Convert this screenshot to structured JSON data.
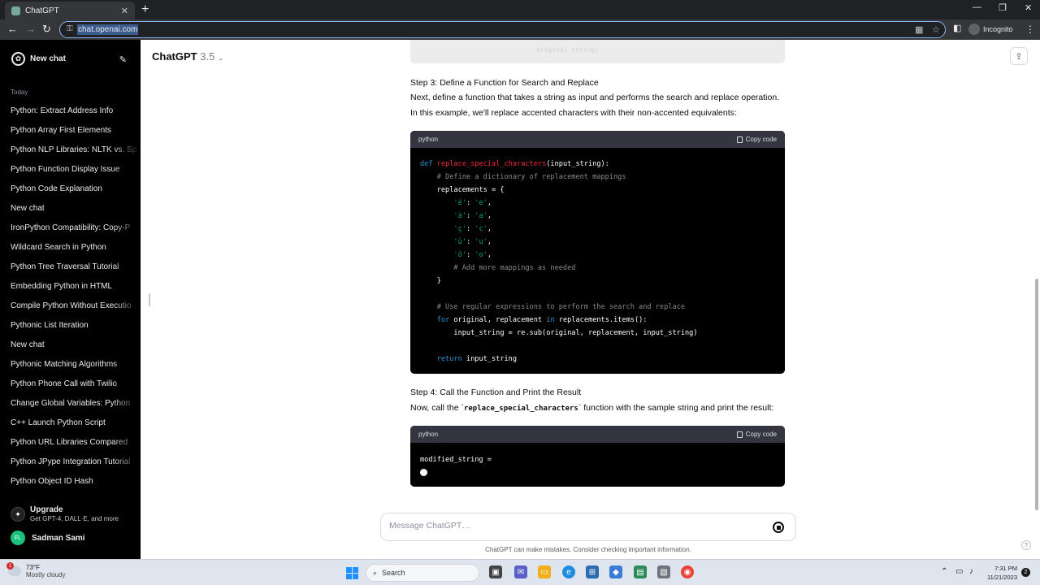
{
  "browser": {
    "tab_title": "ChatGPT",
    "url": "chat.openai.com",
    "incognito_label": "Incognito"
  },
  "sidebar": {
    "new_chat": "New chat",
    "section_today": "Today",
    "items": [
      {
        "label": "Python: Extract Address Info"
      },
      {
        "label": "Python Array First Elements"
      },
      {
        "label": "Python NLP Libraries: NLTK vs. Sp"
      },
      {
        "label": "Python Function Display Issue"
      },
      {
        "label": "Python Code Explanation"
      },
      {
        "label": "New chat"
      },
      {
        "label": "IronPython Compatibility: Copy-P"
      },
      {
        "label": "Wildcard Search in Python"
      },
      {
        "label": "Python Tree Traversal Tutorial"
      },
      {
        "label": "Embedding Python in HTML"
      },
      {
        "label": "Compile Python Without Executio"
      },
      {
        "label": "Pythonic List Iteration"
      },
      {
        "label": "New chat"
      },
      {
        "label": "Pythonic Matching Algorithms"
      },
      {
        "label": "Python Phone Call with Twilio"
      },
      {
        "label": "Change Global Variables: Python"
      },
      {
        "label": "C++ Launch Python Script"
      },
      {
        "label": "Python URL Libraries Compared"
      },
      {
        "label": "Python JPype Integration Tutorial"
      },
      {
        "label": "Python Object ID Hash"
      }
    ],
    "upgrade_title": "Upgrade",
    "upgrade_sub": "Get GPT-4, DALL·E, and more",
    "user_initials": "FL",
    "user_name": "Sadman Sami"
  },
  "main": {
    "model_name": "ChatGPT",
    "model_version": "3.5",
    "prev_code_tail": "original string)",
    "step3_heading": "Step 3: Define a Function for Search and Replace",
    "step3_line1": "Next, define a function that takes a string as input and performs the search and replace operation.",
    "step3_line2": "In this example, we'll replace accented characters with their non-accented equivalents:",
    "code1_lang": "python",
    "copy_label": "Copy code",
    "step4_heading": "Step 4: Call the Function and Print the Result",
    "step4_pre": "Now, call the `",
    "step4_code": "replace_special_characters",
    "step4_post": "` function with the sample string and print the result:",
    "code2_lang": "python",
    "code2_line": "modified_string =",
    "composer_placeholder": "Message ChatGPT…",
    "disclaimer": "ChatGPT can make mistakes. Consider checking important information.",
    "help": "?"
  },
  "code1": {
    "def_kw": "def",
    "fn_name": "replace_special_characters",
    "sig": "(input_string):",
    "comment1": "# Define a dictionary of replacement mappings",
    "dict_open": "replacements = {",
    "pairs": [
      {
        "k": "'é'",
        "v": "'e'"
      },
      {
        "k": "'à'",
        "v": "'a'"
      },
      {
        "k": "'ç'",
        "v": "'c'"
      },
      {
        "k": "'ù'",
        "v": "'u'"
      },
      {
        "k": "'ô'",
        "v": "'o'"
      }
    ],
    "comment2": "# Add more mappings as needed",
    "dict_close": "}",
    "comment3": "# Use regular expressions to perform the search and replace",
    "for_kw": "for",
    "for_vars": "original, replacement",
    "in_kw": "in",
    "for_iter": "replacements.items():",
    "body": "input_string = re.sub(original, replacement, input_string)",
    "return_kw": "return",
    "return_val": "input_string"
  },
  "taskbar": {
    "weather_badge": "1",
    "temp": "73°F",
    "condition": "Mostly cloudy",
    "search": "Search",
    "time": "7:31 PM",
    "date": "11/21/2023",
    "notifications": "2"
  },
  "colors": {
    "sidebar_bg": "#000000",
    "code_bg": "#000000",
    "keyword": "#2e95d3",
    "function": "#f22c3d",
    "string": "#00a67d",
    "comment": "#8a8a8a"
  }
}
